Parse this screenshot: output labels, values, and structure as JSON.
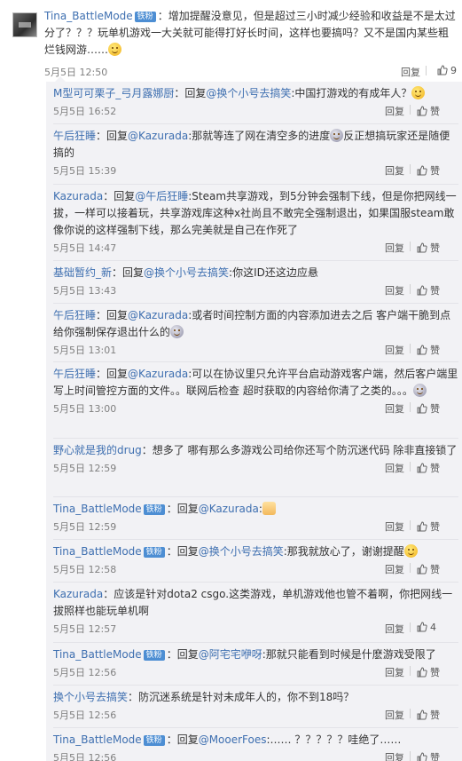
{
  "main_comment": {
    "username": "Tina_BattleMode",
    "badge": "铁粉",
    "text": "：增加提醒没意见，但是超过三小时减少经验和收益是不是太过分了？？？玩单机游戏一大关就可能得打好长时间，这样也要搞吗？又不是国内某些粗烂钱网游……",
    "emoji": "sweat-smile-emoji",
    "time": "5月5日 12:50",
    "reply_label": "回复",
    "like_count": "9"
  },
  "replies": [
    {
      "user": "M型可可栗子_弓月露娜厨",
      "badge": "",
      "pre": "：回复",
      "mention": "@换个小号去搞笑",
      "text": ":中国打游戏的有成年人？",
      "emoji": "smile",
      "time": "5月5日 16:52",
      "reply_label": "回复",
      "like_label": "赞"
    },
    {
      "user": "午后狂睡",
      "badge": "",
      "pre": "：回复",
      "mention": "@Kazurada",
      "text": ":那就等连了网在清空多的进度",
      "emoji": "sad",
      "text2": "反正想搞玩家还是随便搞的",
      "time": "5月5日 15:39",
      "reply_label": "回复",
      "like_label": "赞"
    },
    {
      "user": "Kazurada",
      "badge": "",
      "pre": "：回复",
      "mention": "@午后狂睡",
      "text": ":Steam共享游戏，到5分钟会强制下线，但是你把网线一拔，一样可以接着玩，共享游戏库这种x社尚且不敢完全强制退出，如果国服steam敢像你说的这样强制下线，那么完美就是自己在作死了",
      "time": "5月5日 14:47",
      "reply_label": "回复",
      "like_label": "赞"
    },
    {
      "user": "基础暂约_新",
      "badge": "",
      "pre": "：回复",
      "mention": "@换个小号去搞笑",
      "text": ":你这ID还这边应悬",
      "time": "5月5日 13:43",
      "reply_label": "回复",
      "like_label": "赞"
    },
    {
      "user": "午后狂睡",
      "badge": "",
      "pre": "：回复",
      "mention": "@Kazurada",
      "text": ":或者时间控制方面的内容添加进去之后 客户端干脆到点给你强制保存退出什么的",
      "emoji": "sad",
      "time": "5月5日 13:01",
      "reply_label": "回复",
      "like_label": "赞"
    },
    {
      "user": "午后狂睡",
      "badge": "",
      "pre": "：回复",
      "mention": "@Kazurada",
      "text": ":可以在协议里只允许平台启动游戏客户端，然后客户端里写上时间管控方面的文件。。联网后检查 超时获取的内容给你清了之类的。。。",
      "emoji": "sad",
      "time": "5月5日 13:00",
      "reply_label": "回复",
      "like_label": "赞"
    },
    {
      "user": "野心就是我的drug",
      "badge": "",
      "pre": "：",
      "mention": "",
      "text": "想多了 哪有那么多游戏公司给你还写个防沉迷代码 除非直接锁了",
      "time": "5月5日 12:59",
      "reply_label": "回复",
      "like_label": "赞"
    },
    {
      "user": "Tina_BattleMode",
      "badge": "铁粉",
      "pre": "：回复",
      "mention": "@Kazurada",
      "text": ":",
      "emoji": "hand",
      "time": "5月5日 12:59",
      "reply_label": "回复",
      "like_label": "赞"
    },
    {
      "user": "Tina_BattleMode",
      "badge": "铁粉",
      "pre": "：回复",
      "mention": "@换个小号去搞笑",
      "text": ":那我就放心了，谢谢提醒",
      "emoji": "smile",
      "time": "5月5日 12:58",
      "reply_label": "回复",
      "like_label": "赞"
    },
    {
      "user": "Kazurada",
      "badge": "",
      "pre": "：",
      "mention": "",
      "text": "应该是针对dota2 csgo.这类游戏，单机游戏他也管不着啊，你把网线一拔照样也能玩单机啊",
      "time": "5月5日 12:57",
      "reply_label": "回复",
      "like_label": "4"
    },
    {
      "user": "Tina_BattleMode",
      "badge": "铁粉",
      "pre": "：回复",
      "mention": "@阿宅宅咿呀",
      "text": ":那就只能看到时候是什麽游戏受限了",
      "time": "5月5日 12:56",
      "reply_label": "回复",
      "like_label": "赞"
    },
    {
      "user": "换个小号去搞笑",
      "badge": "",
      "pre": "：",
      "mention": "",
      "text": "防沉迷系统是针对未成年人的，你不到18吗？",
      "time": "5月5日 12:56",
      "reply_label": "回复",
      "like_label": "赞"
    },
    {
      "user": "Tina_BattleMode",
      "badge": "铁粉",
      "pre": "：回复",
      "mention": "@MooerFoes",
      "text": ":…… ？？？？？哇绝了……",
      "time": "5月5日 12:56",
      "reply_label": "回复",
      "like_label": "赞"
    }
  ],
  "colors": {
    "link": "#3e6fb0",
    "text": "#333333",
    "meta": "#808080",
    "panel": "#f2f2f5",
    "badge": "#4d8ed3"
  }
}
